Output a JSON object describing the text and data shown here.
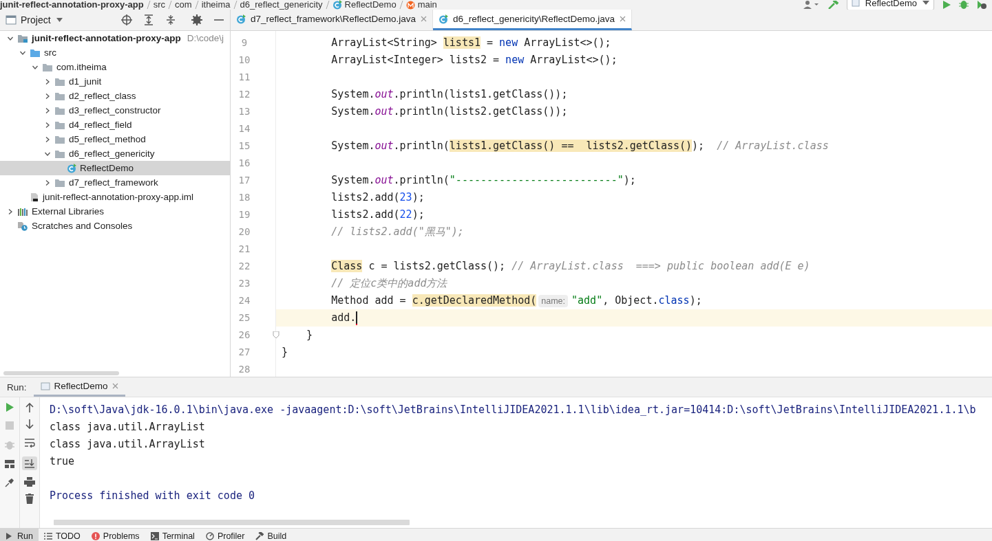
{
  "breadcrumbs": [
    {
      "label": "junit-reflect-annotation-proxy-app",
      "kind": "project"
    },
    {
      "label": "src",
      "kind": "text"
    },
    {
      "label": "com",
      "kind": "text"
    },
    {
      "label": "itheima",
      "kind": "text"
    },
    {
      "label": "d6_reflect_genericity",
      "kind": "text"
    },
    {
      "label": "ReflectDemo",
      "kind": "class"
    },
    {
      "label": "main",
      "kind": "method"
    }
  ],
  "run_config": {
    "label": "ReflectDemo"
  },
  "project_panel": {
    "title": "Project"
  },
  "editor_tabs": [
    {
      "label": "d7_reflect_framework\\ReflectDemo.java",
      "selected": false
    },
    {
      "label": "d6_reflect_genericity\\ReflectDemo.java",
      "selected": true
    }
  ],
  "tree": [
    {
      "label": "junit-reflect-annotation-proxy-app",
      "kind": "module",
      "hint": "D:\\code\\j",
      "expanded": true,
      "selected": false,
      "children": [
        {
          "label": "src",
          "kind": "source",
          "expanded": true,
          "selected": false,
          "children": [
            {
              "label": "com.itheima",
              "kind": "package",
              "expanded": true,
              "selected": false,
              "children": [
                {
                  "label": "d1_junit",
                  "kind": "package",
                  "expanded": false,
                  "selected": false
                },
                {
                  "label": "d2_reflect_class",
                  "kind": "package",
                  "expanded": false,
                  "selected": false
                },
                {
                  "label": "d3_reflect_constructor",
                  "kind": "package",
                  "expanded": false,
                  "selected": false
                },
                {
                  "label": "d4_reflect_field",
                  "kind": "package",
                  "expanded": false,
                  "selected": false
                },
                {
                  "label": "d5_reflect_method",
                  "kind": "package",
                  "expanded": false,
                  "selected": false
                },
                {
                  "label": "d6_reflect_genericity",
                  "kind": "package",
                  "expanded": true,
                  "selected": false,
                  "children": [
                    {
                      "label": "ReflectDemo",
                      "kind": "class",
                      "selected": true
                    }
                  ]
                },
                {
                  "label": "d7_reflect_framework",
                  "kind": "package",
                  "expanded": false,
                  "selected": false
                }
              ]
            }
          ]
        },
        {
          "label": "junit-reflect-annotation-proxy-app.iml",
          "kind": "file",
          "selected": false
        }
      ]
    },
    {
      "label": "External Libraries",
      "kind": "library",
      "expanded": false,
      "selected": false
    },
    {
      "label": "Scratches and Consoles",
      "kind": "scratch",
      "selected": false
    }
  ],
  "code_lines": [
    {
      "number": "9",
      "current": false,
      "fold": false,
      "tokens": [
        {
          "t": "        ArrayList<String> ",
          "kind": "plain"
        },
        {
          "t": "lists1",
          "kind": "hl"
        },
        {
          "t": " = ",
          "kind": "plain"
        },
        {
          "t": "new",
          "kind": "kw"
        },
        {
          "t": " ArrayList<>();",
          "kind": "plain"
        }
      ]
    },
    {
      "number": "10",
      "current": false,
      "fold": false,
      "tokens": [
        {
          "t": "        ArrayList<Integer> lists2 = ",
          "kind": "plain"
        },
        {
          "t": "new",
          "kind": "kw"
        },
        {
          "t": " ArrayList<>();",
          "kind": "plain"
        }
      ]
    },
    {
      "number": "11",
      "current": false,
      "fold": false
    },
    {
      "number": "12",
      "current": false,
      "fold": false,
      "tokens": [
        {
          "t": "        System.",
          "kind": "plain"
        },
        {
          "t": "out",
          "kind": "field"
        },
        {
          "t": ".println(lists1.getClass());",
          "kind": "plain"
        }
      ]
    },
    {
      "number": "13",
      "current": false,
      "fold": false,
      "tokens": [
        {
          "t": "        System.",
          "kind": "plain"
        },
        {
          "t": "out",
          "kind": "field"
        },
        {
          "t": ".println(lists2.getClass());",
          "kind": "plain"
        }
      ]
    },
    {
      "number": "14",
      "current": false,
      "fold": false
    },
    {
      "number": "15",
      "current": false,
      "fold": false,
      "tokens": [
        {
          "t": "        System.",
          "kind": "plain"
        },
        {
          "t": "out",
          "kind": "field"
        },
        {
          "t": ".println(",
          "kind": "plain"
        },
        {
          "t": "lists1.getClass() ==  lists2.getClass()",
          "kind": "hl"
        },
        {
          "t": ");  ",
          "kind": "plain"
        },
        {
          "t": "// ArrayList.class",
          "kind": "comment"
        }
      ]
    },
    {
      "number": "16",
      "current": false,
      "fold": false
    },
    {
      "number": "17",
      "current": false,
      "fold": false,
      "tokens": [
        {
          "t": "        System.",
          "kind": "plain"
        },
        {
          "t": "out",
          "kind": "field"
        },
        {
          "t": ".println(",
          "kind": "plain"
        },
        {
          "t": "\"--------------------------\"",
          "kind": "str"
        },
        {
          "t": ");",
          "kind": "plain"
        }
      ]
    },
    {
      "number": "18",
      "current": false,
      "fold": false,
      "tokens": [
        {
          "t": "        lists2.add(",
          "kind": "plain"
        },
        {
          "t": "23",
          "kind": "num"
        },
        {
          "t": ");",
          "kind": "plain"
        }
      ]
    },
    {
      "number": "19",
      "current": false,
      "fold": false,
      "tokens": [
        {
          "t": "        lists2.add(",
          "kind": "plain"
        },
        {
          "t": "22",
          "kind": "num"
        },
        {
          "t": ");",
          "kind": "plain"
        }
      ]
    },
    {
      "number": "20",
      "current": false,
      "fold": false,
      "tokens": [
        {
          "t": "        // lists2.add(\"黑马\");",
          "kind": "comment"
        }
      ]
    },
    {
      "number": "21",
      "current": false,
      "fold": false
    },
    {
      "number": "22",
      "current": false,
      "fold": false,
      "tokens": [
        {
          "t": "        Class",
          "kind": "hl"
        },
        {
          "t": " c = lists2.getClass(); ",
          "kind": "plain"
        },
        {
          "t": "// ArrayList.class  ===> public boolean add(E e)",
          "kind": "comment"
        }
      ]
    },
    {
      "number": "23",
      "current": false,
      "fold": false,
      "tokens": [
        {
          "t": "        // 定位c类中的add方法",
          "kind": "comment"
        }
      ]
    },
    {
      "number": "24",
      "current": false,
      "fold": false,
      "tokens": [
        {
          "t": "        Method add = ",
          "kind": "plain"
        },
        {
          "t": "c.getDeclaredMethod(",
          "kind": "hl"
        },
        {
          "t": "name:",
          "kind": "hint"
        },
        {
          "t": "\"add\"",
          "kind": "str"
        },
        {
          "t": ", Object.",
          "kind": "plain"
        },
        {
          "t": "class",
          "kind": "kw"
        },
        {
          "t": ");",
          "kind": "plain"
        }
      ]
    },
    {
      "number": "25",
      "current": true,
      "fold": false,
      "tokens": [
        {
          "t": "        add.",
          "kind": "plain"
        }
      ]
    },
    {
      "number": "26",
      "current": false,
      "fold": true,
      "tokens": [
        {
          "t": "    }",
          "kind": "plain"
        }
      ]
    },
    {
      "number": "27",
      "current": false,
      "fold": false,
      "tokens": [
        {
          "t": "}",
          "kind": "plain"
        }
      ]
    },
    {
      "number": "28",
      "current": false,
      "fold": false
    }
  ],
  "run_panel": {
    "label": "Run:",
    "tab": "ReflectDemo",
    "scroll_to_end_on": true,
    "soft_wrap_on": false,
    "console": [
      {
        "text": "D:\\soft\\Java\\jdk-16.0.1\\bin\\java.exe -javaagent:D:\\soft\\JetBrains\\IntelliJIDEA2021.1.1\\lib\\idea_rt.jar=10414:D:\\soft\\JetBrains\\IntelliJIDEA2021.1.1\\b",
        "kind": "system"
      },
      {
        "text": "class java.util.ArrayList",
        "kind": "output"
      },
      {
        "text": "class java.util.ArrayList",
        "kind": "output"
      },
      {
        "text": "true",
        "kind": "output"
      },
      {
        "text": "Process finished with exit code 0",
        "kind": "exit"
      }
    ]
  },
  "tool_strip": [
    {
      "label": "Run",
      "kind": "run",
      "selected": true
    },
    {
      "label": "TODO",
      "kind": "todo",
      "selected": false
    },
    {
      "label": "Problems",
      "kind": "problems",
      "selected": false
    },
    {
      "label": "Terminal",
      "kind": "terminal",
      "selected": false
    },
    {
      "label": "Profiler",
      "kind": "profiler",
      "selected": false
    },
    {
      "label": "Build",
      "kind": "build",
      "selected": false
    }
  ]
}
